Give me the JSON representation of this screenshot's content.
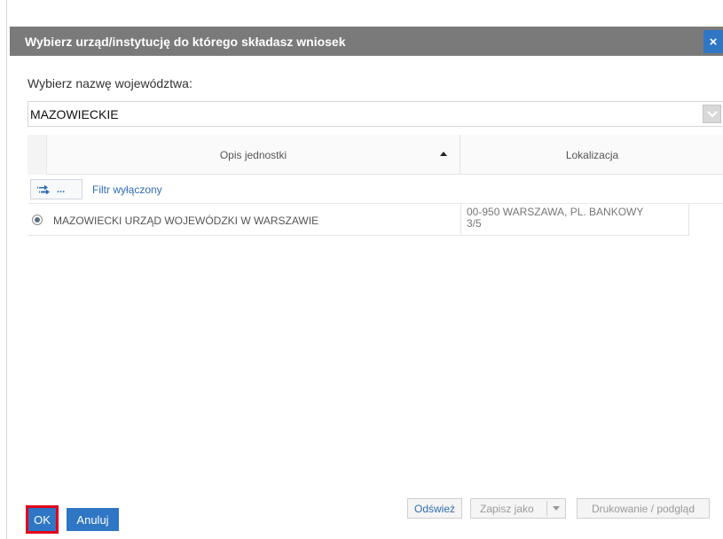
{
  "dialog": {
    "title": "Wybierz urząd/instytucję do którego składasz wniosek",
    "close_label": "×"
  },
  "voivodeship": {
    "label": "Wybierz nazwę województwa:",
    "selected": "MAZOWIECKIE"
  },
  "grid": {
    "columns": [
      "Opis jednostki",
      "Lokalizacja"
    ],
    "sort_column": "Opis jednostki",
    "filter_button": "...",
    "filter_status": "Filtr wyłączony",
    "rows": [
      {
        "description": "MAZOWIECKI URZĄD WOJEWÓDZKI W WARSZAWIE",
        "location_line1": "00-950 WARSZAWA, PL. BANKOWY",
        "location_line2": "3/5",
        "selected": true
      }
    ],
    "buttons": {
      "refresh": "Odśwież",
      "save_as": "Zapisz jako",
      "print": "Drukowanie / podgląd"
    }
  },
  "actions": {
    "ok": "OK",
    "cancel": "Anuluj"
  },
  "colors": {
    "accent": "#2f76c5",
    "titlebar": "#7a7a7a",
    "highlight": "#e3001b",
    "link": "#2f6db2"
  }
}
